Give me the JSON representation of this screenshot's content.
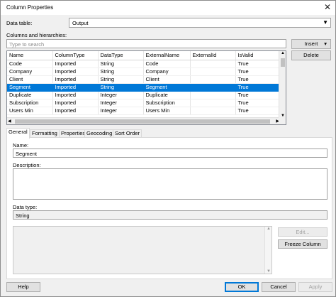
{
  "window": {
    "title": "Column Properties",
    "close_glyph": "✕"
  },
  "data_table": {
    "label": "Data table:",
    "value": "Output"
  },
  "columns_section": {
    "label": "Columns and hierarchies:",
    "search_placeholder": "Type to search",
    "insert_label": "Insert",
    "delete_label": "Delete"
  },
  "grid": {
    "headers": [
      "Name",
      "ColumnType",
      "DataType",
      "ExternalName",
      "ExternalId",
      "IsValid"
    ],
    "selected_row": 3,
    "rows": [
      [
        "Code",
        "Imported",
        "String",
        "Code",
        "",
        "True"
      ],
      [
        "Company",
        "Imported",
        "String",
        "Company",
        "",
        "True"
      ],
      [
        "Client",
        "Imported",
        "String",
        "Client",
        "",
        "True"
      ],
      [
        "Segment",
        "Imported",
        "String",
        "Segment",
        "",
        "True"
      ],
      [
        "Duplicate",
        "Imported",
        "Integer",
        "Duplicate",
        "",
        "True"
      ],
      [
        "Subscription",
        "Imported",
        "Integer",
        "Subscription",
        "",
        "True"
      ],
      [
        "Users Min",
        "Imported",
        "Integer",
        "Users Min",
        "",
        "True"
      ]
    ]
  },
  "tabs": [
    "General",
    "Formatting",
    "Properties",
    "Geocoding",
    "Sort Order"
  ],
  "general": {
    "name_label": "Name:",
    "name_value": "Segment",
    "description_label": "Description:",
    "description_value": "",
    "datatype_label": "Data type:",
    "datatype_value": "String",
    "edit_label": "Edit...",
    "freeze_label": "Freeze Column"
  },
  "footer": {
    "help_label": "Help",
    "ok_label": "OK",
    "cancel_label": "Cancel",
    "apply_label": "Apply"
  },
  "colors": {
    "selection": "#0078d7",
    "window_bg": "#f0f0f0"
  }
}
